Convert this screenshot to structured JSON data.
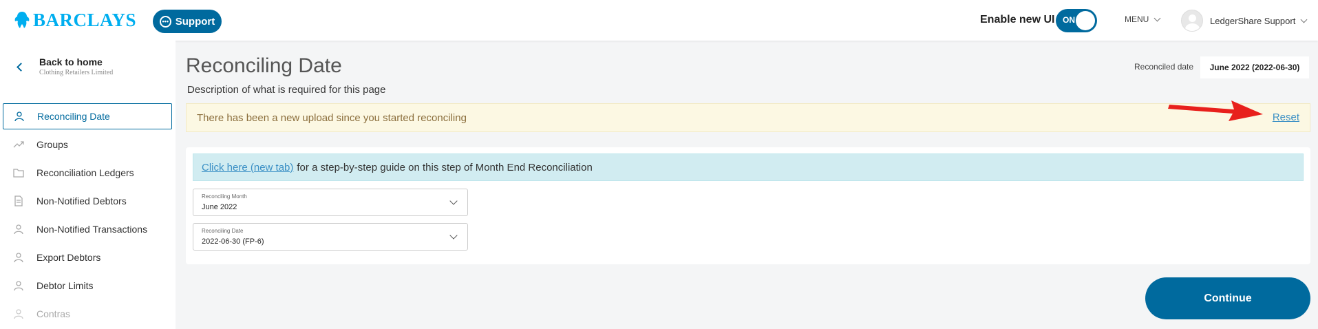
{
  "header": {
    "brand": "BARCLAYS",
    "support_label": "Support",
    "new_ui_label": "Enable new UI",
    "toggle_state": "ON",
    "menu_label": "MENU",
    "user_name": "LedgerShare Support"
  },
  "sidebar": {
    "back_title": "Back to home",
    "back_subtitle": "Clothing Retailers Limited",
    "items": [
      {
        "label": "Reconciling Date",
        "icon": "person-icon",
        "active": true
      },
      {
        "label": "Groups",
        "icon": "trend-icon"
      },
      {
        "label": "Reconciliation Ledgers",
        "icon": "folder-icon"
      },
      {
        "label": "Non-Notified Debtors",
        "icon": "document-icon"
      },
      {
        "label": "Non-Notified Transactions",
        "icon": "person-icon"
      },
      {
        "label": "Export Debtors",
        "icon": "person-icon"
      },
      {
        "label": "Debtor Limits",
        "icon": "person-icon"
      },
      {
        "label": "Contras",
        "icon": "person-icon",
        "disabled": true
      }
    ]
  },
  "main": {
    "title": "Reconciling Date",
    "description": "Description of what is required for this page",
    "reconciled_label": "Reconciled date",
    "reconciled_value": "June 2022 (2022-06-30)",
    "alert_text": "There has been a new upload since you started reconciling",
    "reset_label": "Reset",
    "info_link": "Click here (new tab)",
    "info_text": "for a step-by-step guide on this step of Month End Reconciliation",
    "month_select": {
      "label": "Reconciling Month",
      "value": "June 2022"
    },
    "date_select": {
      "label": "Reconciling Date",
      "value": "2022-06-30 (FP-6)"
    },
    "continue_label": "Continue"
  },
  "colors": {
    "brand_blue": "#00aeef",
    "primary": "#006a9e",
    "alert_bg": "#fcf8e3",
    "info_bg": "#d1ecf1",
    "annotation_arrow": "#e8201c"
  }
}
